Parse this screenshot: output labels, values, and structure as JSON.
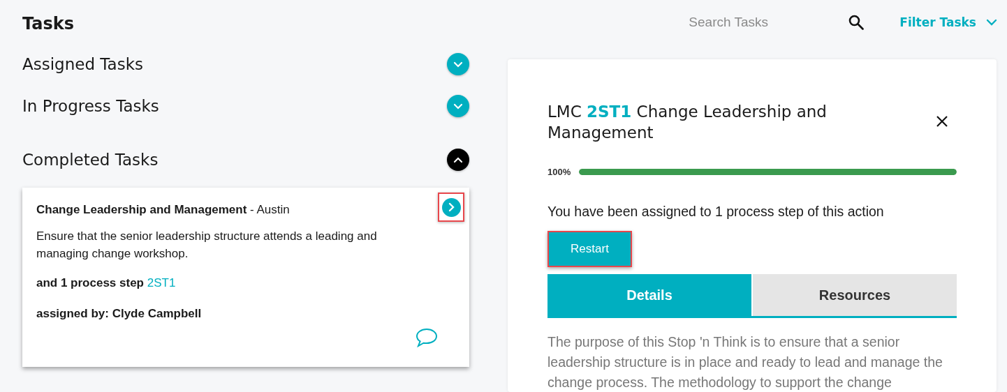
{
  "header": {
    "title": "Tasks",
    "search": {
      "placeholder": "Search Tasks"
    },
    "filter": {
      "label": "Filter Tasks"
    }
  },
  "sections": [
    {
      "title": "Assigned Tasks",
      "expanded": false
    },
    {
      "title": "In Progress Tasks",
      "expanded": false
    },
    {
      "title": "Completed Tasks",
      "expanded": true
    }
  ],
  "task_card": {
    "title": "Change Leadership and Management",
    "location": "- Austin",
    "description": "Ensure that the senior leadership structure attends a leading and managing change workshop.",
    "steps_label": "and 1 process step",
    "step_code": "2ST1",
    "assigned_by": "assigned by: Clyde Campbell",
    "open_highlighted": true
  },
  "detail": {
    "title_prefix": "LMC",
    "code": "2ST1",
    "title": "Change Leadership and Management",
    "progress_label": "100%",
    "level": 1,
    "message": "You have been assigned to 1 process step of this action",
    "button": {
      "label": "Restart",
      "highlighted": true
    },
    "tabs": [
      {
        "label": "Details",
        "selected": true
      },
      {
        "label": "Resources",
        "selected": false
      }
    ],
    "body": "The purpose of this Stop 'n Think is to ensure that a senior leadership structure is in place and ready to lead and manage the change process. The methodology to support the change"
  }
}
